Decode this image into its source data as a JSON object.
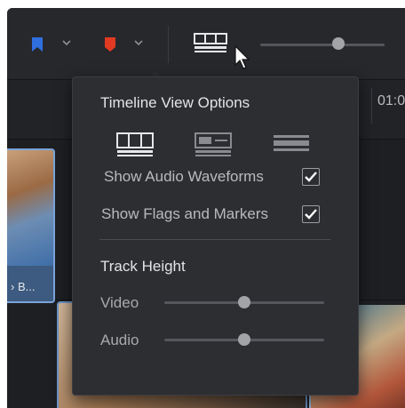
{
  "toolbar": {
    "flag_icon": "flag-icon",
    "flag_color": "#2f6fe0",
    "marker_icon": "marker-icon",
    "marker_color": "#e03a22",
    "view_icon": "timeline-view-options-icon"
  },
  "ruler": {
    "timecode": "01:0"
  },
  "clips": {
    "clip1_caption": "› B..."
  },
  "popover": {
    "title": "Timeline View Options",
    "view_modes": [
      "stacked-timeline-icon",
      "filmstrip-view-icon",
      "simplified-view-icon"
    ],
    "show_audio_waveforms": {
      "label": "Show Audio Waveforms",
      "checked": true
    },
    "show_flags_markers": {
      "label": "Show Flags and Markers",
      "checked": true
    },
    "track_height_title": "Track Height",
    "video": {
      "label": "Video",
      "value": 0.5
    },
    "audio": {
      "label": "Audio",
      "value": 0.5
    }
  }
}
